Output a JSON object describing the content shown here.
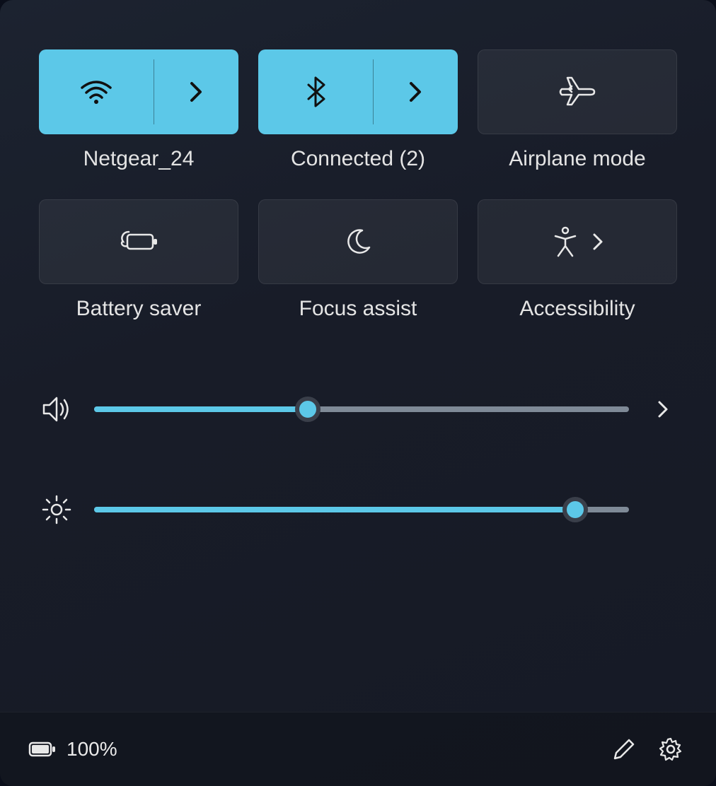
{
  "accent": "#5cc8e8",
  "tiles": [
    {
      "id": "wifi",
      "label": "Netgear_24",
      "active": true,
      "split": true,
      "icon": "wifi-icon"
    },
    {
      "id": "bluetooth",
      "label": "Connected (2)",
      "active": true,
      "split": true,
      "icon": "bluetooth-icon"
    },
    {
      "id": "airplane",
      "label": "Airplane mode",
      "active": false,
      "split": false,
      "icon": "airplane-icon"
    },
    {
      "id": "battery-saver",
      "label": "Battery saver",
      "active": false,
      "split": false,
      "icon": "battery-saver-icon"
    },
    {
      "id": "focus-assist",
      "label": "Focus assist",
      "active": false,
      "split": false,
      "icon": "moon-icon"
    },
    {
      "id": "accessibility",
      "label": "Accessibility",
      "active": false,
      "split": false,
      "expand_inline": true,
      "icon": "accessibility-icon"
    }
  ],
  "sliders": {
    "volume": {
      "percent": 40,
      "expandable": true
    },
    "brightness": {
      "percent": 90,
      "expandable": false
    }
  },
  "footer": {
    "battery_percent": "100%"
  }
}
